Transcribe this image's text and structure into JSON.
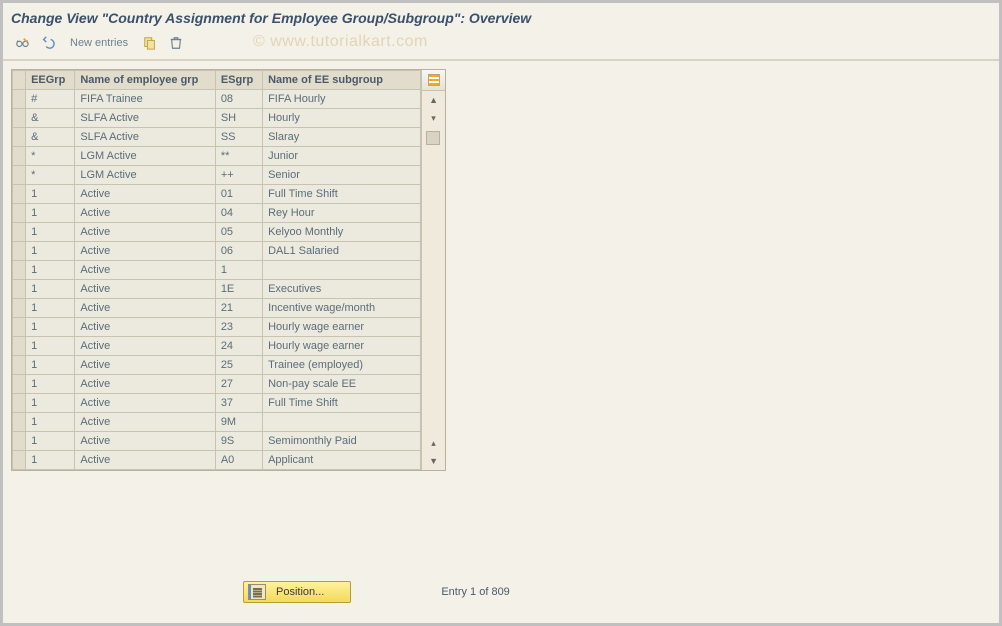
{
  "title": "Change View \"Country Assignment for Employee Group/Subgroup\": Overview",
  "watermark": "© www.tutorialkart.com",
  "toolbar": {
    "new_entries_label": "New entries"
  },
  "table": {
    "columns": {
      "eegrp": "EEGrp",
      "name": "Name of employee grp",
      "esgrp": "ESgrp",
      "sub": "Name of EE subgroup"
    },
    "rows": [
      {
        "eegrp": "#",
        "name": "FIFA Trainee",
        "esgrp": "08",
        "sub": "FIFA Hourly"
      },
      {
        "eegrp": "&",
        "name": "SLFA Active",
        "esgrp": "SH",
        "sub": "Hourly"
      },
      {
        "eegrp": "&",
        "name": "SLFA Active",
        "esgrp": "SS",
        "sub": "Slaray"
      },
      {
        "eegrp": "*",
        "name": "LGM Active",
        "esgrp": "**",
        "sub": "Junior"
      },
      {
        "eegrp": "*",
        "name": "LGM Active",
        "esgrp": "++",
        "sub": "Senior"
      },
      {
        "eegrp": "1",
        "name": "Active",
        "esgrp": "01",
        "sub": "Full Time Shift"
      },
      {
        "eegrp": "1",
        "name": "Active",
        "esgrp": "04",
        "sub": "Rey Hour"
      },
      {
        "eegrp": "1",
        "name": "Active",
        "esgrp": "05",
        "sub": "Kelyoo Monthly"
      },
      {
        "eegrp": "1",
        "name": "Active",
        "esgrp": "06",
        "sub": "DAL1 Salaried"
      },
      {
        "eegrp": "1",
        "name": "Active",
        "esgrp": "1",
        "sub": ""
      },
      {
        "eegrp": "1",
        "name": "Active",
        "esgrp": "1E",
        "sub": "Executives"
      },
      {
        "eegrp": "1",
        "name": "Active",
        "esgrp": "21",
        "sub": "Incentive wage/month"
      },
      {
        "eegrp": "1",
        "name": "Active",
        "esgrp": "23",
        "sub": "Hourly wage earner"
      },
      {
        "eegrp": "1",
        "name": "Active",
        "esgrp": "24",
        "sub": "Hourly wage earner"
      },
      {
        "eegrp": "1",
        "name": "Active",
        "esgrp": "25",
        "sub": "Trainee (employed)"
      },
      {
        "eegrp": "1",
        "name": "Active",
        "esgrp": "27",
        "sub": "Non-pay scale EE"
      },
      {
        "eegrp": "1",
        "name": "Active",
        "esgrp": "37",
        "sub": "Full Time Shift"
      },
      {
        "eegrp": "1",
        "name": "Active",
        "esgrp": "9M",
        "sub": ""
      },
      {
        "eegrp": "1",
        "name": "Active",
        "esgrp": "9S",
        "sub": "Semimonthly Paid"
      },
      {
        "eegrp": "1",
        "name": "Active",
        "esgrp": "A0",
        "sub": "Applicant"
      }
    ]
  },
  "footer": {
    "position_label": "Position...",
    "entry_status": "Entry 1 of 809"
  }
}
